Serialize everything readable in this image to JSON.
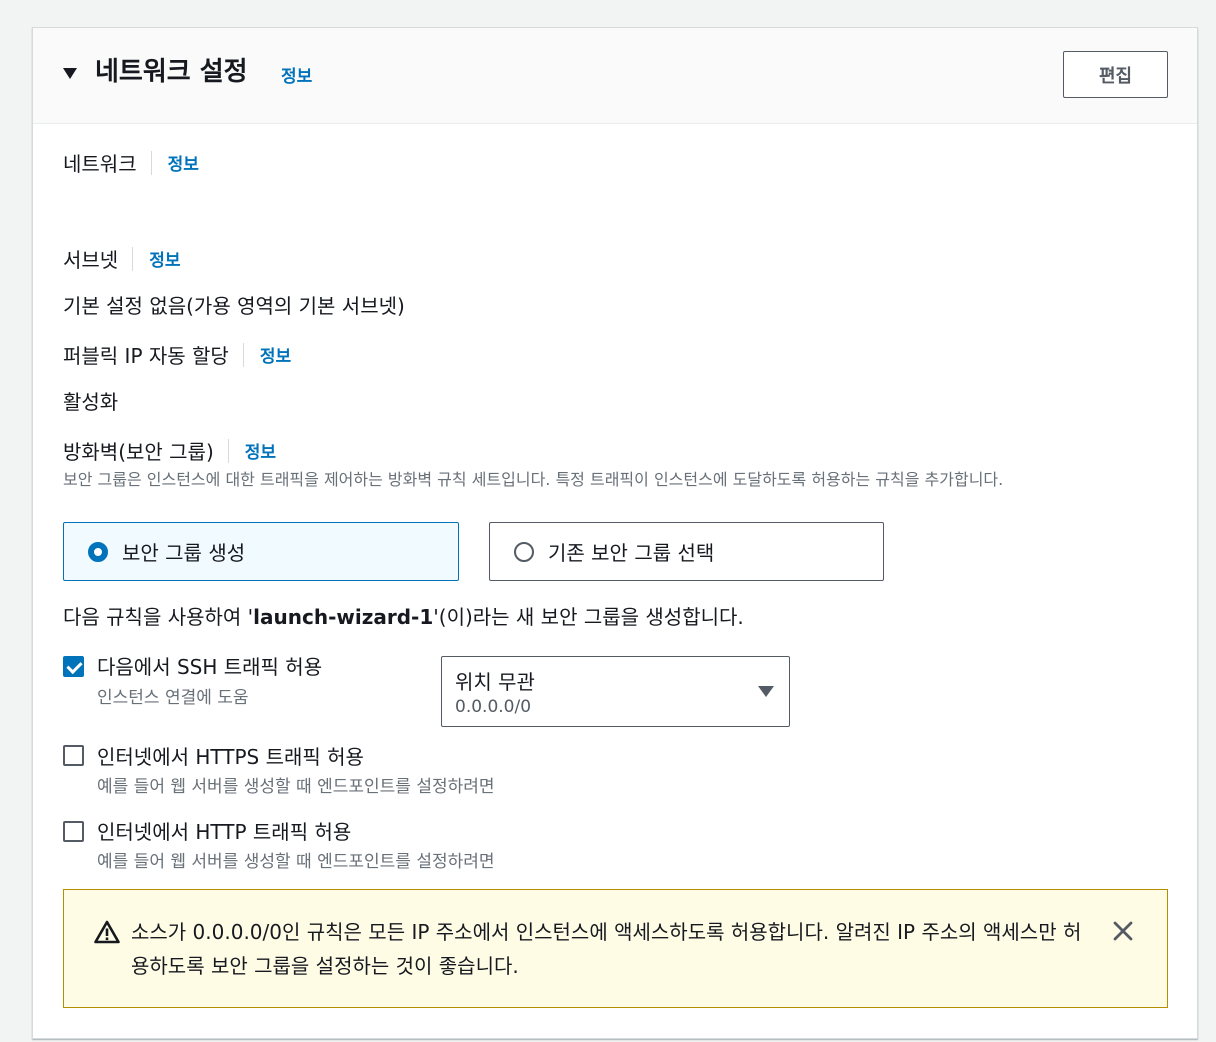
{
  "section": {
    "title": "네트워크 설정",
    "info": "정보",
    "edit_label": "편집"
  },
  "network": {
    "label": "네트워크",
    "info": "정보"
  },
  "subnet": {
    "label": "서브넷",
    "info": "정보",
    "value": "기본 설정 없음(가용 영역의 기본 서브넷)"
  },
  "public_ip": {
    "label": "퍼블릭 IP 자동 할당",
    "info": "정보",
    "value": "활성화"
  },
  "firewall": {
    "label": "방화벽(보안 그룹)",
    "info": "정보",
    "description": "보안 그룹은 인스턴스에 대한 트래픽을 제어하는 방화벽 규칙 세트입니다. 특정 트래픽이 인스턴스에 도달하도록 허용하는 규칙을 추가합니다.",
    "options": [
      {
        "label": "보안 그룹 생성",
        "selected": true
      },
      {
        "label": "기존 보안 그룹 선택",
        "selected": false
      }
    ],
    "rule_prefix": "다음 규칙을 사용하여 '",
    "group_name": "launch-wizard-1",
    "rule_suffix": "'(이)라는 새 보안 그룹을 생성합니다."
  },
  "rules": [
    {
      "label": "다음에서 SSH 트래픽 허용",
      "desc": "인스턴스 연결에 도움",
      "checked": true
    },
    {
      "label": "인터넷에서 HTTPS 트래픽 허용",
      "desc": "예를 들어 웹 서버를 생성할 때 엔드포인트를 설정하려면",
      "checked": false
    },
    {
      "label": "인터넷에서 HTTP 트래픽 허용",
      "desc": "예를 들어 웹 서버를 생성할 때 엔드포인트를 설정하려면",
      "checked": false
    }
  ],
  "ssh_source": {
    "value": "위치 무관",
    "sub": "0.0.0.0/0"
  },
  "alert": {
    "text": "소스가 0.0.0.0/0인 규칙은 모든 IP 주소에서 인스턴스에 액세스하도록 허용합니다. 알려진 IP 주소의 액세스만 허용하도록 보안 그룹을 설정하는 것이 좋습니다."
  },
  "colors": {
    "link": "#0073bb",
    "selected_bg": "#f1faff",
    "warning_bg": "#fffce6",
    "warning_border": "#b38f00"
  },
  "icons": [
    "caret-down-icon",
    "warning-icon",
    "close-icon",
    "check-icon"
  ]
}
